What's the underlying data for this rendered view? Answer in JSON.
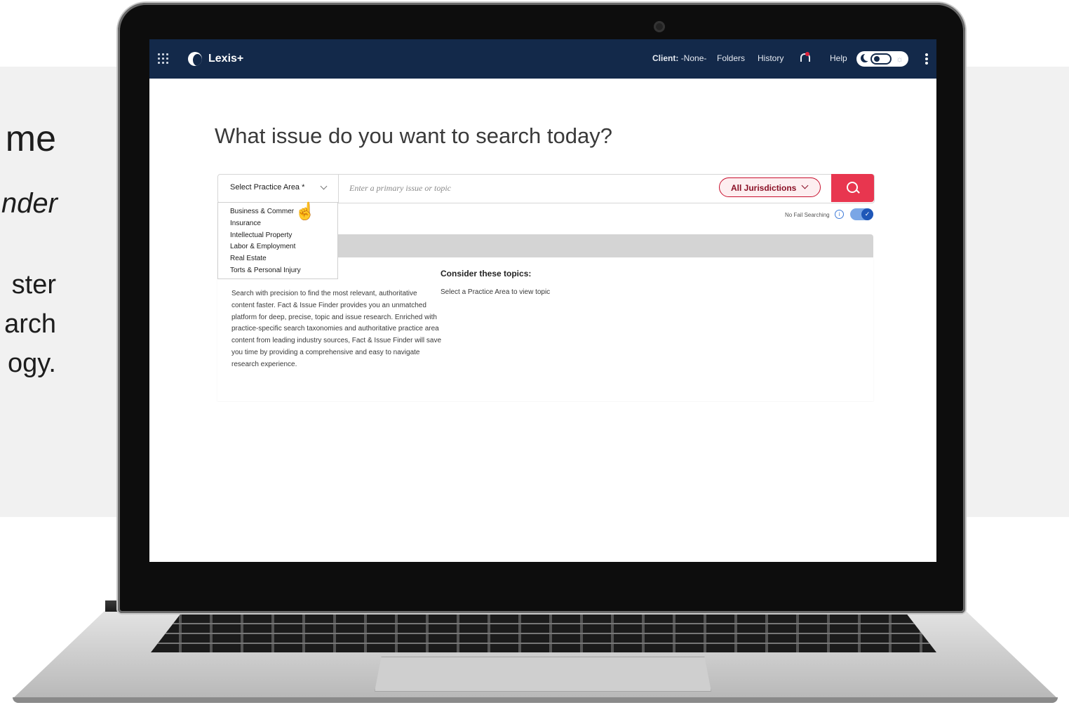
{
  "promo": {
    "title": "me",
    "subtitle": "nder",
    "body_lines": [
      "ster",
      "arch",
      "ogy."
    ]
  },
  "header": {
    "brand": "Lexis+",
    "client_label": "Client:",
    "client_value": "-None-",
    "nav": [
      "Folders",
      "History"
    ],
    "help": "Help",
    "icons": [
      "apps-grid-icon",
      "bell-icon",
      "moon-icon",
      "sun-icon",
      "kebab-icon"
    ],
    "accent": "#13294a"
  },
  "main": {
    "headline": "What issue do you want to search today?",
    "practice_select": "Select Practice Area *",
    "search_placeholder": "Enter a primary issue or topic",
    "jurisdiction": "All Jurisdictions",
    "no_fail": "No Fail Searching",
    "consider": "Consider these topics:",
    "description": "Search with precision to find the most relevant, authoritative content faster. Fact & Issue Finder provides you an unmatched platform for deep, precise, topic and issue research. Enriched with practice-specific search taxonomies and authoritative practice area content from leading industry sources, Fact & Issue Finder will save you time by providing a comprehensive and easy to navigate research experience.",
    "topic_hint": "Select a Practice Area to view topic",
    "search_button_color": "#e8364f"
  },
  "dropdown": {
    "items": [
      "Business & Commer",
      "Insurance",
      "Intellectual Property",
      "Labor & Employment",
      "Real Estate",
      "Torts & Personal Injury"
    ]
  }
}
